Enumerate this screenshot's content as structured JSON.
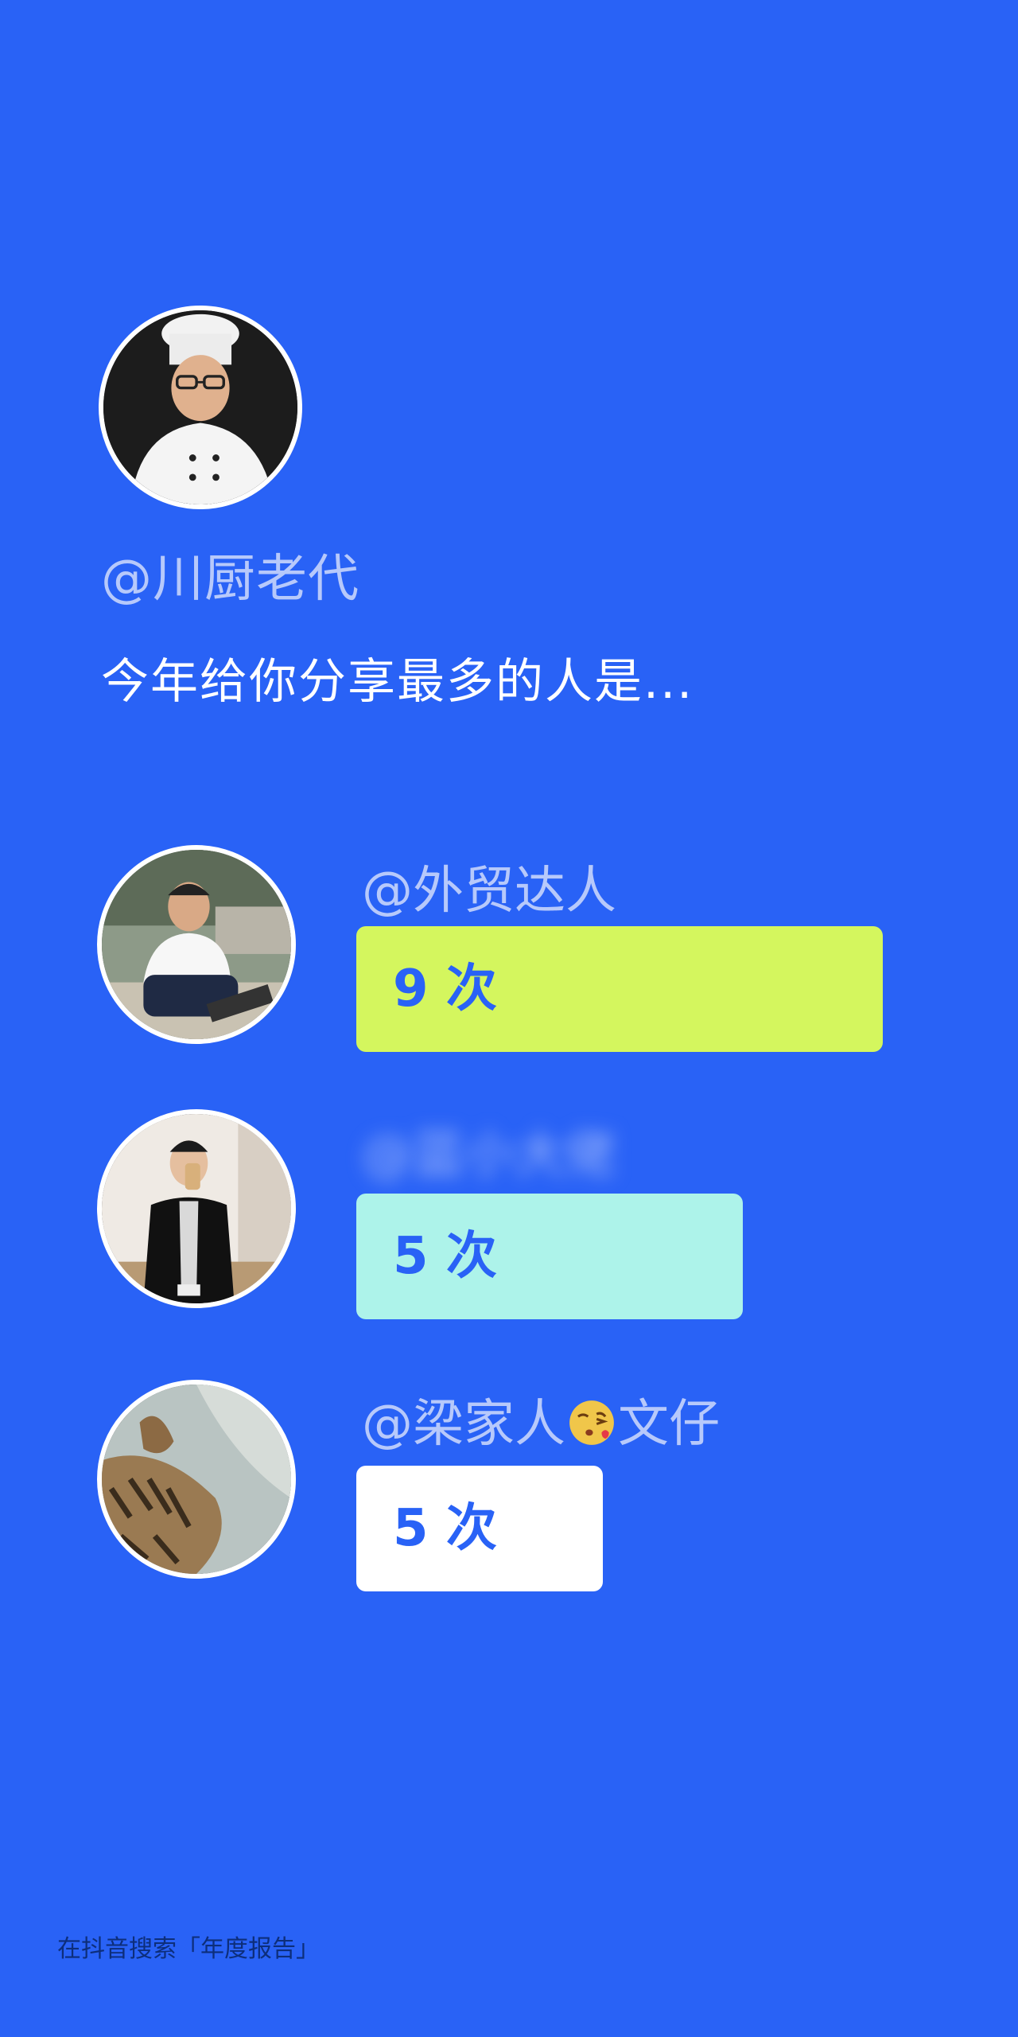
{
  "owner": {
    "name": "@川厨老代",
    "avatar_icon": "chef-avatar-icon"
  },
  "headline": "今年给你分享最多的人是...",
  "friends": [
    {
      "name": "@外贸达人",
      "count_label": "9 次",
      "count": 9,
      "bar_color": "#d4f65e",
      "avatar_icon": "man-laptop-avatar-icon"
    },
    {
      "name": "@蓝小大佬",
      "count_label": "5 次",
      "count": 5,
      "bar_color": "#adf3ea",
      "avatar_icon": "man-selfie-avatar-icon"
    },
    {
      "name_prefix": "@梁家人",
      "name_suffix": "文仔",
      "emoji_icon": "kissing-face-emoji-icon",
      "count_label": "5 次",
      "count": 5,
      "bar_color": "#ffffff",
      "avatar_icon": "cat-avatar-icon"
    }
  ],
  "footer": "在抖音搜索「年度报告」",
  "colors": {
    "background": "#2962f6",
    "accent_text": "#2962f6",
    "name_text": "#b7c9fb"
  }
}
